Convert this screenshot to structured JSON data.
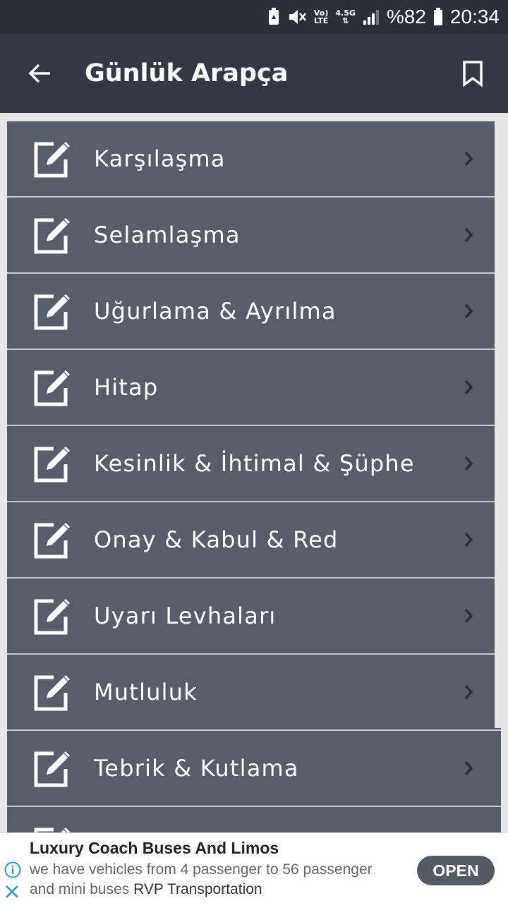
{
  "status_bar": {
    "network_top": "Vo)",
    "network_bottom": "LTE",
    "data_type": "4.5G",
    "battery": "%82",
    "time": "20:34"
  },
  "app_bar": {
    "title": "Günlük Arapça",
    "back_icon": "arrow-left-icon",
    "bookmark_icon": "bookmark-icon"
  },
  "list": {
    "item_icon": "edit-square-icon",
    "items": [
      {
        "label": "Karşılaşma"
      },
      {
        "label": "Selamlaşma"
      },
      {
        "label": "Uğurlama & Ayrılma"
      },
      {
        "label": "Hitap"
      },
      {
        "label": "Kesinlik & İhtimal & Şüphe"
      },
      {
        "label": "Onay & Kabul & Red"
      },
      {
        "label": "Uyarı Levhaları"
      },
      {
        "label": "Mutluluk"
      },
      {
        "label": "Tebrik & Kutlama"
      },
      {
        "label": ""
      }
    ]
  },
  "ad": {
    "title": "Luxury Coach Buses And Limos",
    "description": "we have vehicles from 4 passenger to 56 passenger and mini buses",
    "advertiser": "RVP Transportation",
    "button": "OPEN"
  },
  "colors": {
    "status_bar_bg": "#2a2f38",
    "app_bar_bg": "#333944",
    "list_item_bg": "#585e69",
    "page_bg": "#e6e6e6",
    "ad_button_bg": "#545a64"
  }
}
